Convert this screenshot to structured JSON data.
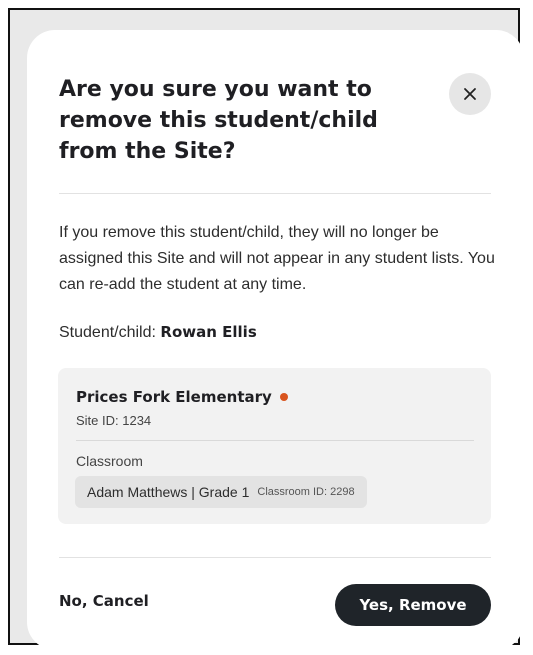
{
  "dialog": {
    "title": "Are you sure you want to remove this student/child from the Site?",
    "close_icon": "close-icon",
    "description": "If you remove this student/child, they will no longer be assigned this Site and will not appear in any student lists. You can re-add the student at any time.",
    "student_label": "Student/child:",
    "student_name": "Rowan Ellis"
  },
  "site": {
    "name": "Prices Fork Elementary",
    "status_color": "#d9541e",
    "site_id": "Site ID: 1234",
    "classroom_label": "Classroom",
    "classroom_name": "Adam Matthews | Grade 1",
    "classroom_id": "Classroom ID: 2298"
  },
  "actions": {
    "cancel_label": "No, Cancel",
    "remove_label": "Yes, Remove"
  },
  "colors": {
    "primary_button": "#1f2429",
    "accent_dot": "#d9541e"
  }
}
